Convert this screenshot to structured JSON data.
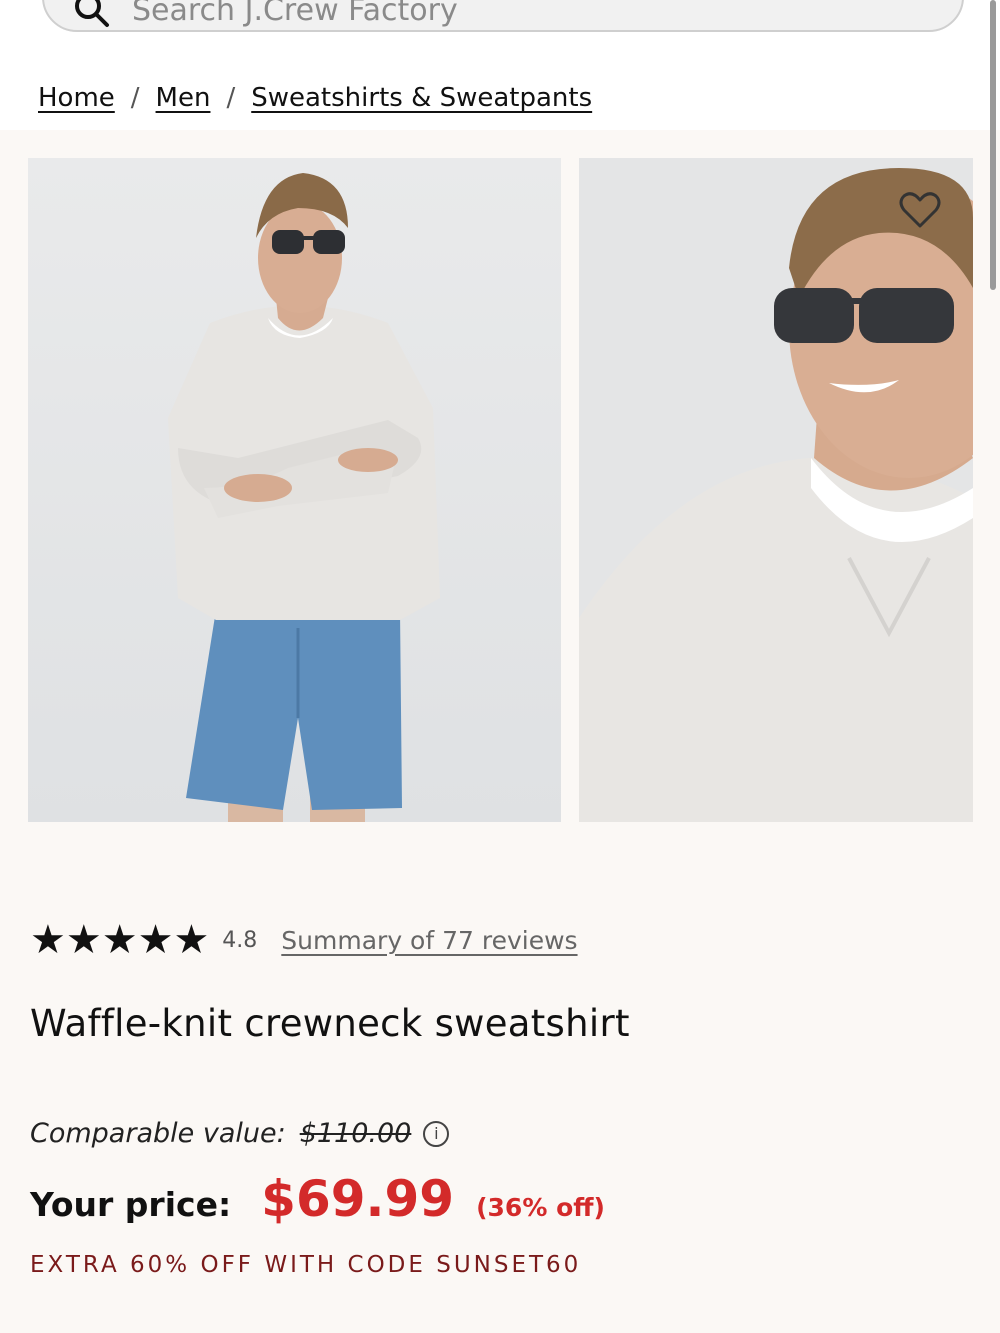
{
  "search": {
    "placeholder": "Search J.Crew Factory"
  },
  "breadcrumb": [
    {
      "label": "Home"
    },
    {
      "label": "Men"
    },
    {
      "label": "Sweatshirts & Sweatpants"
    }
  ],
  "breadcrumb_separator": "/",
  "product": {
    "rating": "4.8",
    "stars": "★★★★★",
    "reviews_link": "Summary of 77 reviews",
    "title": "Waffle-knit crewneck sweatshirt",
    "comparable_label": "Comparable value:",
    "comparable_price": "$110.00",
    "price_label": "Your price:",
    "price": "$69.99",
    "discount": "(36% off)",
    "promo": "EXTRA 60% OFF WITH CODE SUNSET60"
  },
  "colors": {
    "sale_red": "#d32a2a",
    "promo_red": "#7a1a1a",
    "page_bg": "#fbf8f5",
    "shorts_blue": "#5f8fbd",
    "sweater_gray": "#e7e5e2"
  },
  "icons": {
    "search": "search-icon",
    "wishlist": "heart-icon",
    "info": "info-icon"
  }
}
